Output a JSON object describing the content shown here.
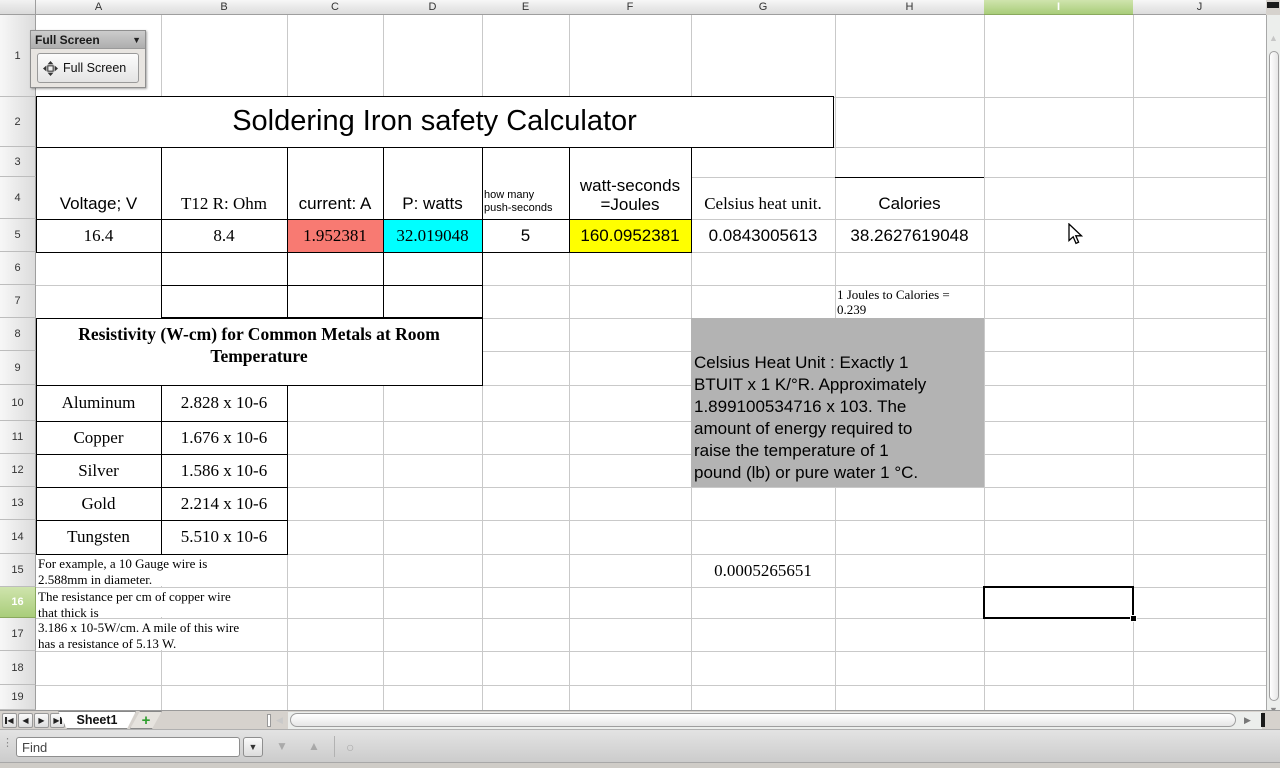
{
  "columns": [
    "A",
    "B",
    "C",
    "D",
    "E",
    "F",
    "G",
    "H",
    "I",
    "J"
  ],
  "rows": [
    "1",
    "2",
    "3",
    "4",
    "5",
    "6",
    "7",
    "8",
    "9",
    "10",
    "11",
    "12",
    "13",
    "14",
    "15",
    "16",
    "17",
    "18",
    "19"
  ],
  "selection": {
    "column": "I",
    "row": "16"
  },
  "fullscreen_toolbar": {
    "title": "Full Screen",
    "button": "Full Screen"
  },
  "sheet": {
    "title": "Soldering Iron safety Calculator",
    "col_headers": {
      "voltage": "Voltage; V",
      "t12": "T12 R: Ohm",
      "current": "current: A",
      "power": "P: watts",
      "push": "how many\npush-seconds",
      "joules": "watt-seconds\n=Joules",
      "chu": "Celsius heat unit.",
      "calories": "Calories"
    },
    "values": {
      "voltage": "16.4",
      "t12": "8.4",
      "current": "1.952381",
      "power": "32.019048",
      "push": "5",
      "joules": "160.0952381",
      "chu": "0.0843005613",
      "calories": "38.2627619048"
    },
    "joules_to_calories_note": "1 Joules to Calories =\n0.239",
    "chu_definition": "Celsius Heat Unit : Exactly 1\nBTUIT x 1 K/°R. Approximately\n1.899100534716 x 103. The\namount of energy required to\nraise the temperature of 1\npound (lb) or pure water 1 °C.",
    "resistivity_heading": "Resistivity (W-cm) for Common Metals at Room\nTemperature",
    "metals": [
      {
        "name": "Aluminum",
        "value": "2.828 x 10-6"
      },
      {
        "name": "Copper",
        "value": "1.676 x 10-6"
      },
      {
        "name": "Silver",
        "value": "1.586 x 10-6"
      },
      {
        "name": "Gold",
        "value": "2.214 x 10-6"
      },
      {
        "name": "Tungsten",
        "value": "5.510 x 10-6"
      }
    ],
    "gauge_notes": [
      "For example, a 10 Gauge wire is\n2.588mm in diameter.",
      "The resistance per cm of copper wire\nthat thick is",
      "3.186 x 10-5W/cm. A mile of this wire\nhas a resistance of 5.13 W."
    ],
    "chu_per_joule": "0.0005265651"
  },
  "sheet_tabs": {
    "active": "Sheet1"
  },
  "find_bar": {
    "placeholder": "Find"
  },
  "icons": {
    "dropdown": "▼",
    "scroll_up": "▲",
    "scroll_down": "▼",
    "scroll_left": "◀",
    "scroll_right": "▶",
    "nav_prev": "◀",
    "nav_next": "▶",
    "nav_first": "◀",
    "nav_last": "▶",
    "add_sheet": "+",
    "grip": "⋮",
    "find_next": "▼",
    "find_previous": "▲",
    "find_all": "○"
  },
  "colors": {
    "current_cell_bg": "#f87a72",
    "power_cell_bg": "#00ffff",
    "joules_cell_bg": "#ffff00",
    "chu_note_bg": "#b3b3b3",
    "selected_header_bg": "#b9d78a",
    "selection_border": "#000000",
    "gridline": "#c9c9c9"
  }
}
